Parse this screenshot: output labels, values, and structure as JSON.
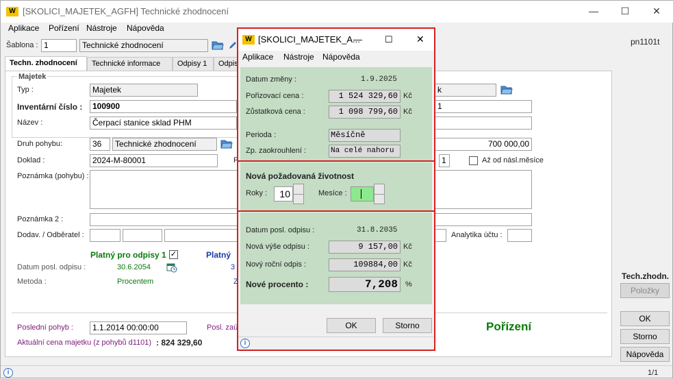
{
  "window": {
    "title": "[SKOLICI_MAJETEK_AGFH] Technické zhodnocení",
    "logo": "W",
    "controls": [
      "—",
      "☐",
      "✕"
    ]
  },
  "menu": [
    "Aplikace",
    "Pořízení",
    "Nástroje",
    "Nápověda"
  ],
  "right_code": "pn1101t",
  "sablona": {
    "label": "Šablona :",
    "number": "1",
    "name": "Technické zhodnocení"
  },
  "tabs": [
    "Techn. zhodnocení",
    "Technické informace",
    "Odpisy 1",
    "Odpis"
  ],
  "form": {
    "group_title": "Majetek",
    "typ_label": "Typ :",
    "typ_value": "Majetek",
    "inv_label": "Inventární číslo :",
    "inv_value": "100900",
    "nazev_label": "Název :",
    "nazev_value": "Čerpací stanice sklad PHM",
    "right_field_1_tail": "k",
    "right_field_2_tail": "1",
    "druh_label": "Druh pohybu:",
    "druh_code": "36",
    "druh_name": "Technické zhodnocení",
    "amount_value": "700 000,00",
    "doklad_label": "Doklad :",
    "doklad_value": "2024-M-80001",
    "doklad_right_char": "F",
    "small_num": "1",
    "az_od_label": "Až od násl.měsíce",
    "poznamka_label": "Poznámka (pohybu) :",
    "poznamka2_label": "Poznámka 2 :",
    "dodav_label": "Dodav. / Odběratel :",
    "analytika_label": "Analytika účtu :",
    "platny1_label": "Platný pro odpisy 1",
    "platny1_checked": "✓",
    "platny2_label": "Platný",
    "datum_posl_label": "Datum posl. odpisu :",
    "datum_posl_value": "30.6.2054",
    "datum_posl_col2": "3",
    "metoda_label": "Metoda :",
    "metoda_value": "Procentem",
    "metoda_col2": "Z",
    "posledni_label": "Poslední pohyb :",
    "posledni_value": "1.1.2014 00:00:00",
    "posl_zau_label": "Posl. zaú",
    "porizeni_label": "Pořízení",
    "aktualni_label": "Aktuální cena majetku  (z pohybů d1101)",
    "aktualni_value": ": 824 329,60"
  },
  "right_panel": {
    "heading": "Tech.zhodn.",
    "polozky": "Položky",
    "ok": "OK",
    "storno": "Storno",
    "napoveda": "Nápověda"
  },
  "status": {
    "page": "1/1",
    "info": "i"
  },
  "dialog": {
    "title": "[SKOLICI_MAJETEK_A...",
    "controls": [
      "—",
      "☐",
      "✕"
    ],
    "menu": [
      "Aplikace",
      "Nástroje",
      "Nápověda"
    ],
    "sec1": {
      "datum_zmeny_label": "Datum změny :",
      "datum_zmeny_value": "1.9.2025",
      "porizovaci_label": "Pořizovací cena :",
      "porizovaci_value": "1 524 329,60",
      "zustatkova_label": "Zůstatková cena :",
      "zustatkova_value": "1 098 799,60",
      "currency": "Kč",
      "perioda_label": "Perioda :",
      "perioda_value": "Měsíčně",
      "zaokr_label": "Zp. zaokrouhlení :",
      "zaokr_value": "Na celé nahoru"
    },
    "sec2": {
      "title": "Nová požadovaná životnost",
      "roky_label": "Roky :",
      "roky_value": "10",
      "mesice_label": "Mesíce :",
      "mesice_value": ""
    },
    "sec3": {
      "datum_posl_label": "Datum posl. odpisu :",
      "datum_posl_value": "31.8.2035",
      "nova_vyse_label": "Nová výše odpisu :",
      "nova_vyse_value": "9 157,00",
      "novy_rocni_label": "Nový roční odpis :",
      "novy_rocni_value": "109884,00",
      "currency": "Kč",
      "nove_procento_label": "Nové procento :",
      "nove_procento_value": "7,208",
      "percent": "%"
    },
    "ok": "OK",
    "storno": "Storno",
    "info": "i"
  },
  "colors": {
    "dialog_border": "#d42020",
    "dialog_section": "#c4ddc4",
    "green_text": "#0a7a0a",
    "blue_text": "#1a3aa8",
    "purple_text": "#7b1a7b",
    "logo": "#f2c200"
  }
}
